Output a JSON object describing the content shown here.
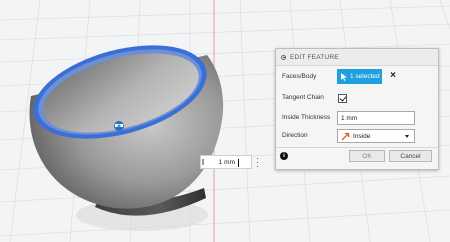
{
  "panel": {
    "title": "EDIT FEATURE",
    "faces_label": "Faces/Body",
    "faces_value": "1 selected",
    "tangent_label": "Tangent Chain",
    "tangent_checked": true,
    "thickness_label": "Inside Thickness",
    "thickness_value": "1 mm",
    "direction_label": "Direction",
    "direction_value": "Inside",
    "ok_label": "OK",
    "cancel_label": "Cancel",
    "info_icon": "i"
  },
  "canvas": {
    "dimension_value": "1 mm",
    "icons": [
      "arrow-cursor-icon",
      "close-icon",
      "check-icon",
      "direction-arrow-icon",
      "info-icon",
      "more-options-icon",
      "manipulator-icon"
    ]
  },
  "colors": {
    "accent": "#1e9fde",
    "shell_rim": "#3a6fd8",
    "body_gray": "#8c8c8c"
  }
}
